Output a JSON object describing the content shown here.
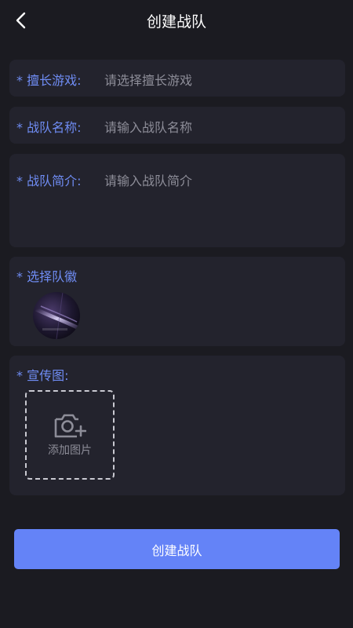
{
  "header": {
    "title": "创建战队",
    "back_icon": "chevron-left-icon"
  },
  "form": {
    "game": {
      "label": "* 擅长游戏:",
      "placeholder": "请选择擅长游戏"
    },
    "team_name": {
      "label": "* 战队名称:",
      "placeholder": "请输入战队名称"
    },
    "team_intro": {
      "label": "* 战队简介:",
      "placeholder": "请输入战队简介"
    },
    "badge": {
      "label": "* 选择队徽"
    },
    "poster": {
      "label": "* 宣传图:",
      "upload_text": "添加图片",
      "upload_icon": "camera-add-icon"
    }
  },
  "submit": {
    "label": "创建战队"
  },
  "colors": {
    "background": "#1b1b21",
    "card": "#23232d",
    "accent_label": "#6f8cf3",
    "button": "#6483f7",
    "placeholder": "#8d8d98"
  }
}
